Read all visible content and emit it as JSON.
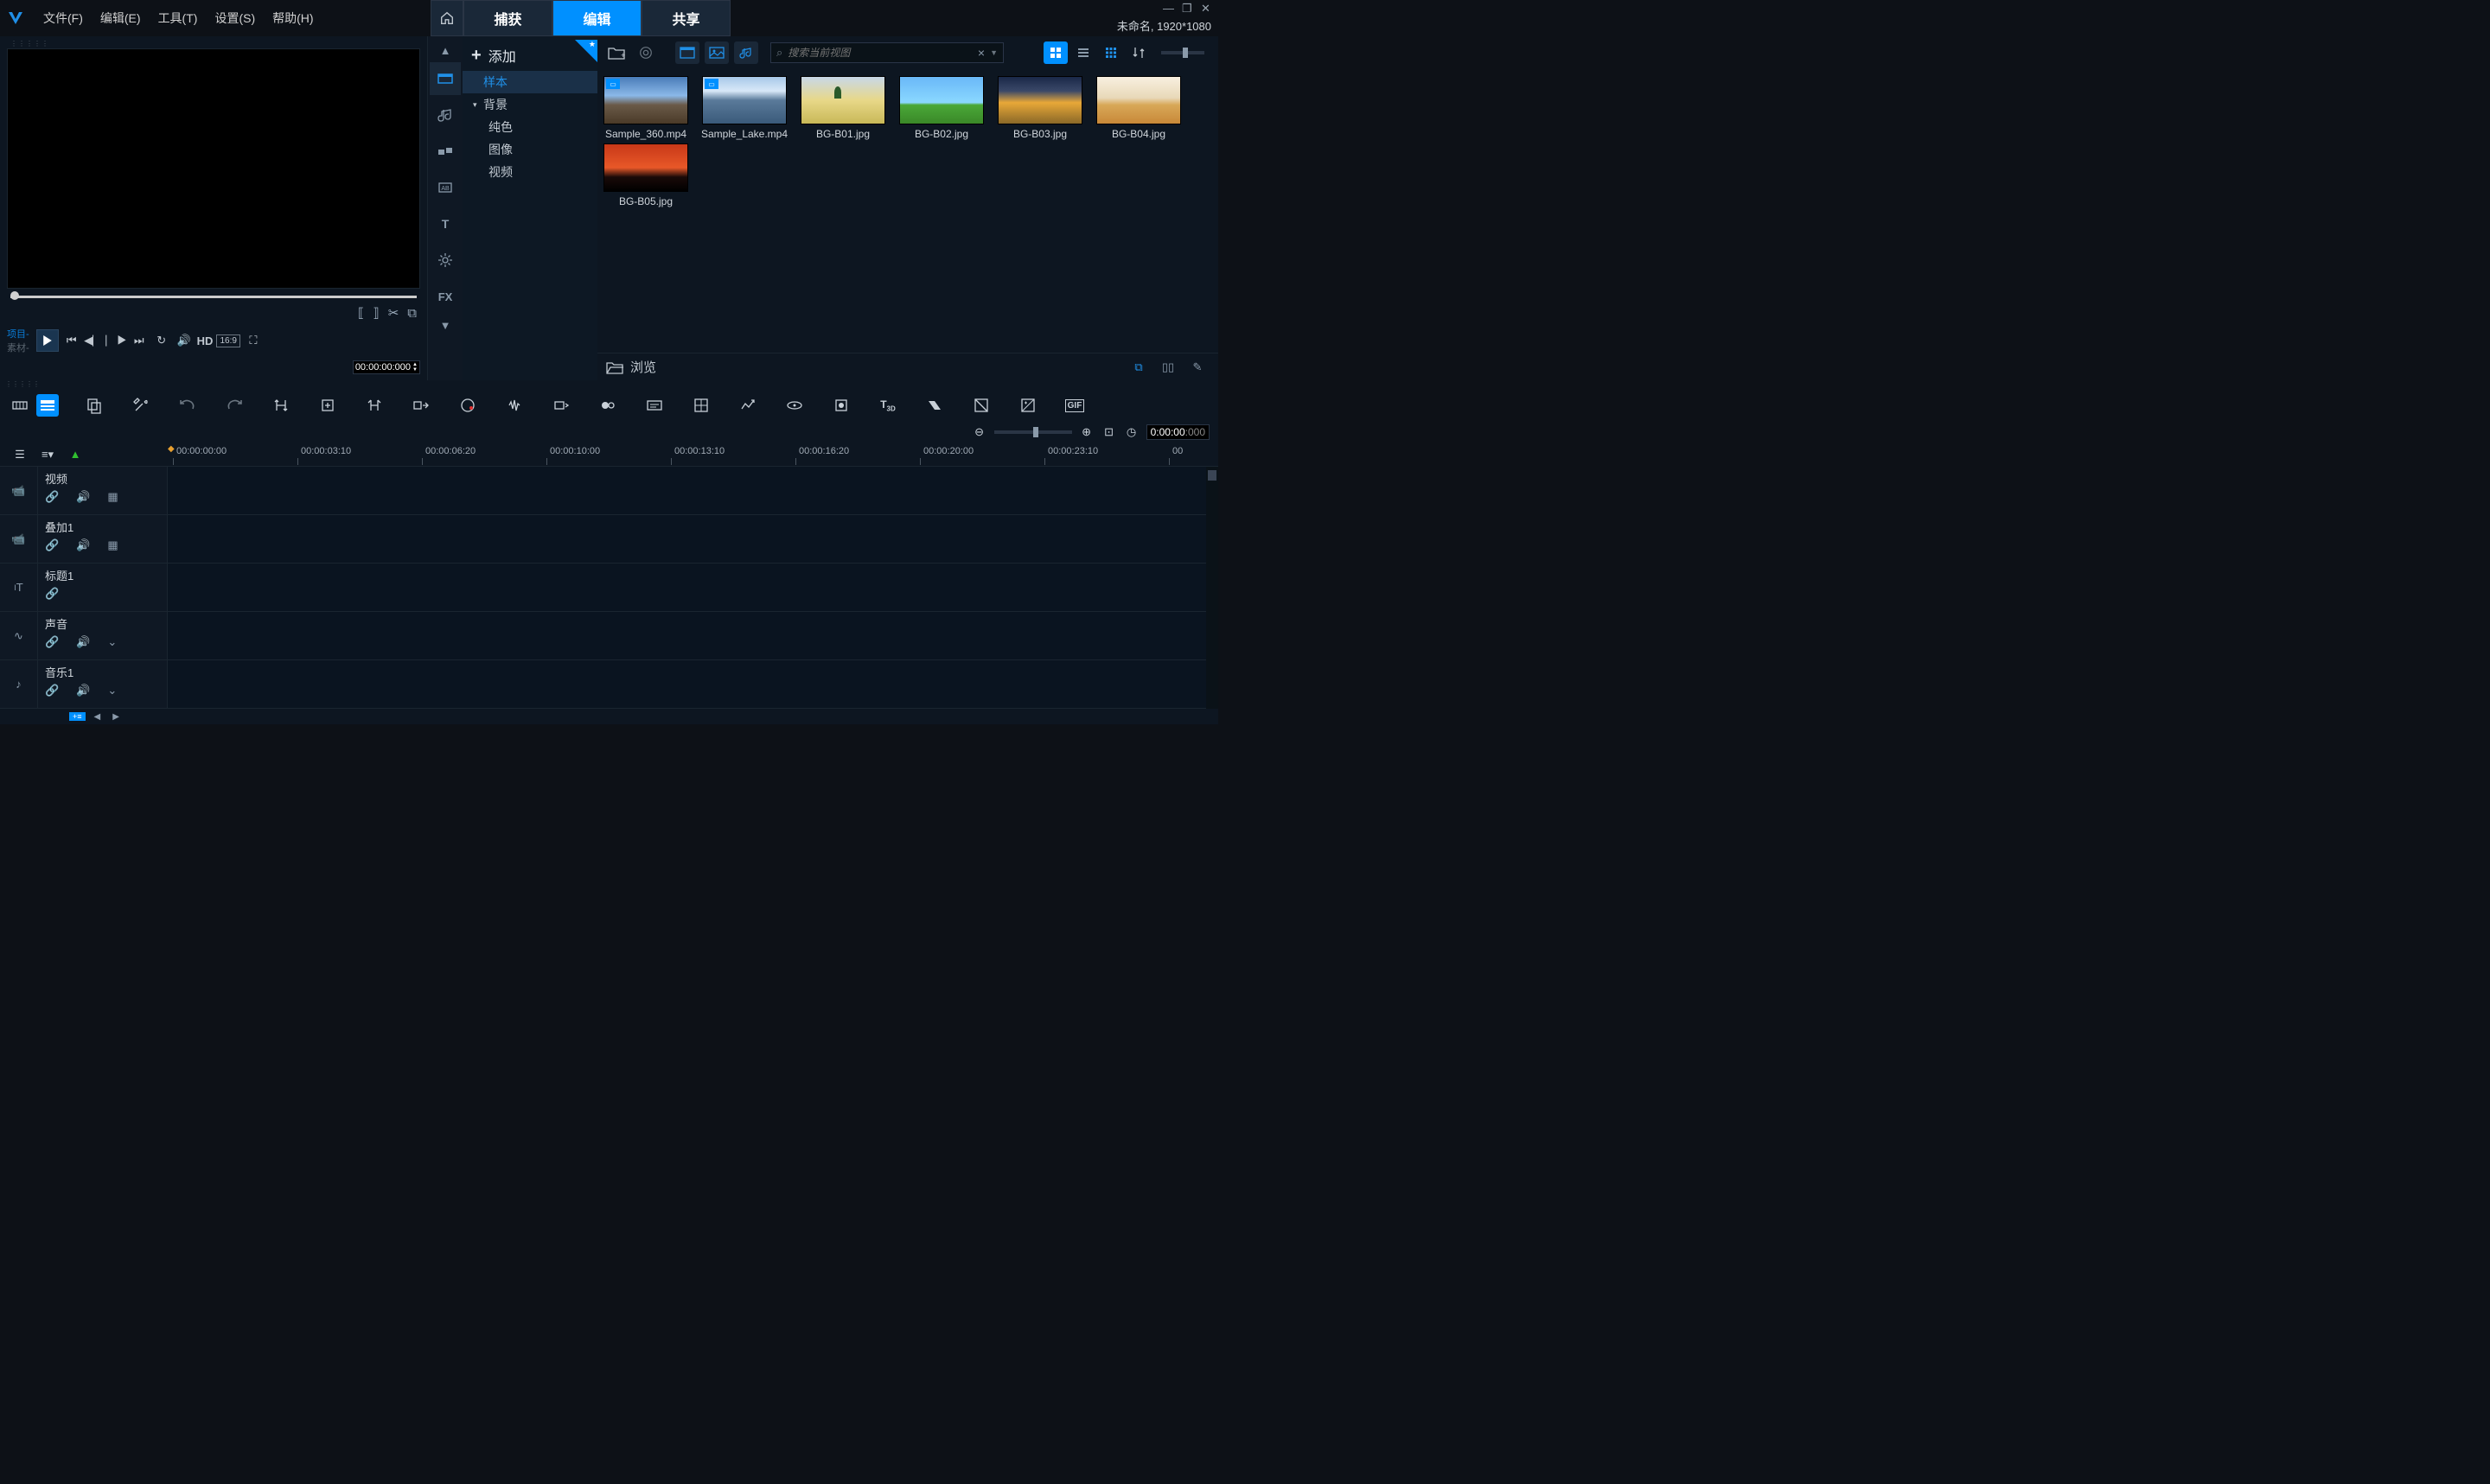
{
  "menu": {
    "file": "文件(F)",
    "edit": "编辑(E)",
    "tools": "工具(T)",
    "settings": "设置(S)",
    "help": "帮助(H)"
  },
  "tabs": {
    "capture": "捕获",
    "edit": "编辑",
    "share": "共享"
  },
  "doc_info": "未命名, 1920*1080",
  "preview": {
    "mode_project": "项目-",
    "mode_clip": "素材-",
    "hd": "HD",
    "ratio": "16:9",
    "timecode": "00:00:00:000"
  },
  "library": {
    "add": "添加",
    "tree": {
      "sample": "样本",
      "background": "背景",
      "solid": "纯色",
      "image": "图像",
      "video": "视频"
    },
    "search_placeholder": "搜索当前视图",
    "items": [
      {
        "label": "Sample_360.mp4",
        "thumb": "thumb-360",
        "badge": "▭"
      },
      {
        "label": "Sample_Lake.mp4",
        "thumb": "thumb-lake",
        "badge": "▭"
      },
      {
        "label": "BG-B01.jpg",
        "thumb": "thumb-b01"
      },
      {
        "label": "BG-B02.jpg",
        "thumb": "thumb-b02"
      },
      {
        "label": "BG-B03.jpg",
        "thumb": "thumb-b03"
      },
      {
        "label": "BG-B04.jpg",
        "thumb": "thumb-b04"
      },
      {
        "label": "BG-B05.jpg",
        "thumb": "thumb-b05"
      }
    ],
    "browse": "浏览"
  },
  "timeline": {
    "timecode_main": "0:00:00",
    "timecode_frames": ":000",
    "ruler": [
      {
        "pos": 10,
        "label": "00:00:00:00"
      },
      {
        "pos": 154,
        "label": "00:00:03:10"
      },
      {
        "pos": 298,
        "label": "00:00:06:20"
      },
      {
        "pos": 442,
        "label": "00:00:10:00"
      },
      {
        "pos": 586,
        "label": "00:00:13:10"
      },
      {
        "pos": 730,
        "label": "00:00:16:20"
      },
      {
        "pos": 874,
        "label": "00:00:20:00"
      },
      {
        "pos": 1018,
        "label": "00:00:23:10"
      },
      {
        "pos": 1162,
        "label": "00"
      }
    ],
    "tracks": [
      {
        "name": "视频",
        "type": "video",
        "icon": "📹",
        "ctrls": [
          "link",
          "vol",
          "fx"
        ]
      },
      {
        "name": "叠加1",
        "type": "overlay",
        "icon": "📹",
        "ctrls": [
          "link",
          "vol",
          "fx"
        ]
      },
      {
        "name": "标题1",
        "type": "title",
        "icon": "T",
        "ctrls": [
          "link"
        ]
      },
      {
        "name": "声音",
        "type": "voice",
        "icon": "∿",
        "ctrls": [
          "link",
          "vol",
          "expand"
        ]
      },
      {
        "name": "音乐1",
        "type": "music",
        "icon": "♪",
        "ctrls": [
          "link",
          "vol",
          "expand"
        ]
      }
    ]
  }
}
